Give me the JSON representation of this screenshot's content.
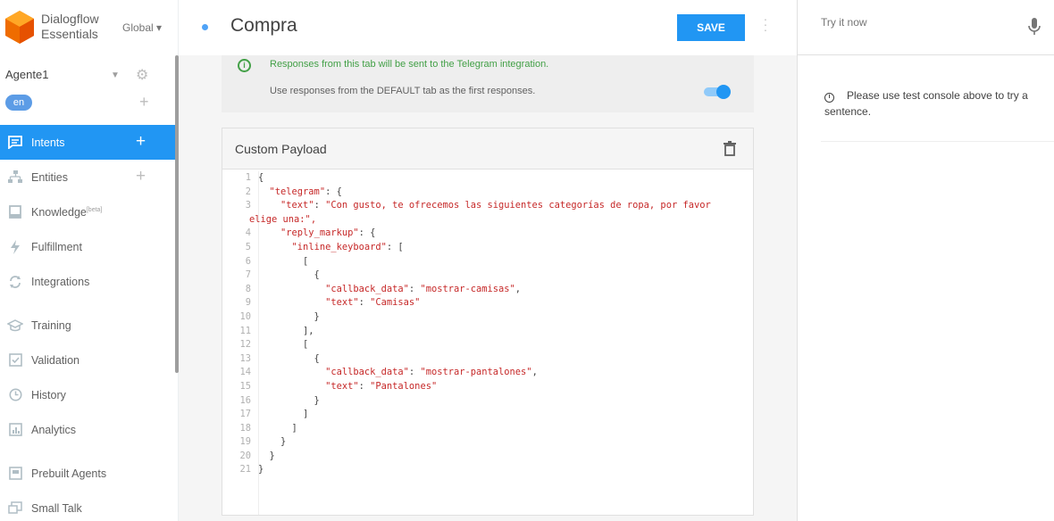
{
  "brand": {
    "name_line1": "Dialogflow",
    "name_line2": "Essentials",
    "region": "Global ▾"
  },
  "agent": {
    "name": "Agente1",
    "language": "en"
  },
  "nav": {
    "items": [
      {
        "label": "Intents",
        "icon": "chat-bubble-icon"
      },
      {
        "label": "Entities",
        "icon": "hierarchy-icon"
      },
      {
        "label": "Knowledge",
        "badge": "[beta]",
        "icon": "book-icon"
      },
      {
        "label": "Fulfillment",
        "icon": "lightning-icon"
      },
      {
        "label": "Integrations",
        "icon": "sync-icon"
      },
      {
        "label": "Training",
        "icon": "graduation-cap-icon"
      },
      {
        "label": "Validation",
        "icon": "check-box-icon"
      },
      {
        "label": "History",
        "icon": "clock-icon"
      },
      {
        "label": "Analytics",
        "icon": "bar-chart-icon"
      },
      {
        "label": "Prebuilt Agents",
        "icon": "prebuilt-icon"
      },
      {
        "label": "Small Talk",
        "icon": "small-talk-icon"
      }
    ]
  },
  "header": {
    "title": "Compra",
    "save_label": "SAVE"
  },
  "info": {
    "telegram_notice": "Responses from this tab will be sent to the Telegram integration.",
    "default_toggle_label": "Use responses from the DEFAULT tab as the first responses."
  },
  "payload": {
    "title": "Custom Payload",
    "line_numbers": [
      "1",
      "2",
      "3",
      "4",
      "5",
      "6",
      "7",
      "8",
      "9",
      "10",
      "11",
      "12",
      "13",
      "14",
      "15",
      "16",
      "17",
      "18",
      "19",
      "20",
      "21"
    ]
  },
  "test_console": {
    "placeholder": "Try it now",
    "hint": "Please use test console above to try a sentence."
  },
  "colors": {
    "accent": "#2196f3",
    "success": "#43a047",
    "code_string": "#c62828"
  }
}
